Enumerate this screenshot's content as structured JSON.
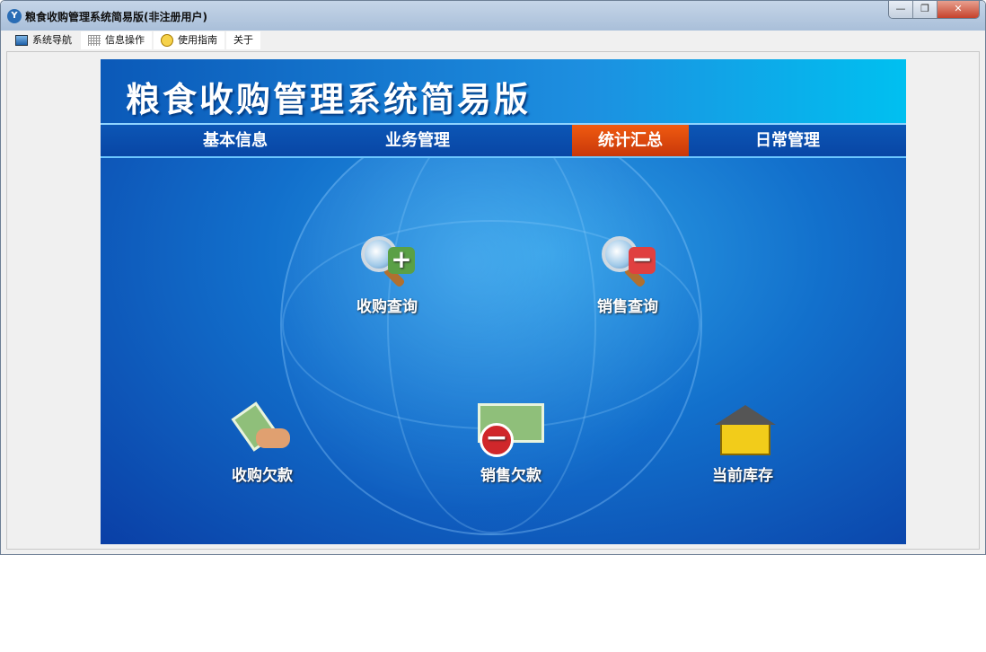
{
  "window": {
    "title": "粮食收购管理系统简易版(非注册用户)",
    "app_icon": "Y",
    "controls": {
      "minimize": "—",
      "restore": "❐",
      "close": "✕"
    }
  },
  "tabs": [
    {
      "label": "系统导航",
      "icon": "monitor-icon"
    },
    {
      "label": "信息操作",
      "icon": "grid-icon"
    },
    {
      "label": "使用指南",
      "icon": "help-icon"
    },
    {
      "label": "关于"
    }
  ],
  "header": {
    "title": "粮食收购管理系统简易版"
  },
  "nav": [
    {
      "label": "基本信息"
    },
    {
      "label": "业务管理"
    },
    {
      "label": "统计汇总",
      "selected": true
    },
    {
      "label": "日常管理"
    }
  ],
  "functions": [
    {
      "label": "收购查询",
      "icon": "magnifier-plus-icon"
    },
    {
      "label": "销售查询",
      "icon": "magnifier-minus-icon"
    },
    {
      "label": "收购欠款",
      "icon": "money-hand-icon"
    },
    {
      "label": "销售欠款",
      "icon": "money-minus-icon"
    },
    {
      "label": "当前库存",
      "icon": "warehouse-icon"
    }
  ],
  "colors": {
    "accent": "#d9440c",
    "nav": "#0a4fae"
  }
}
